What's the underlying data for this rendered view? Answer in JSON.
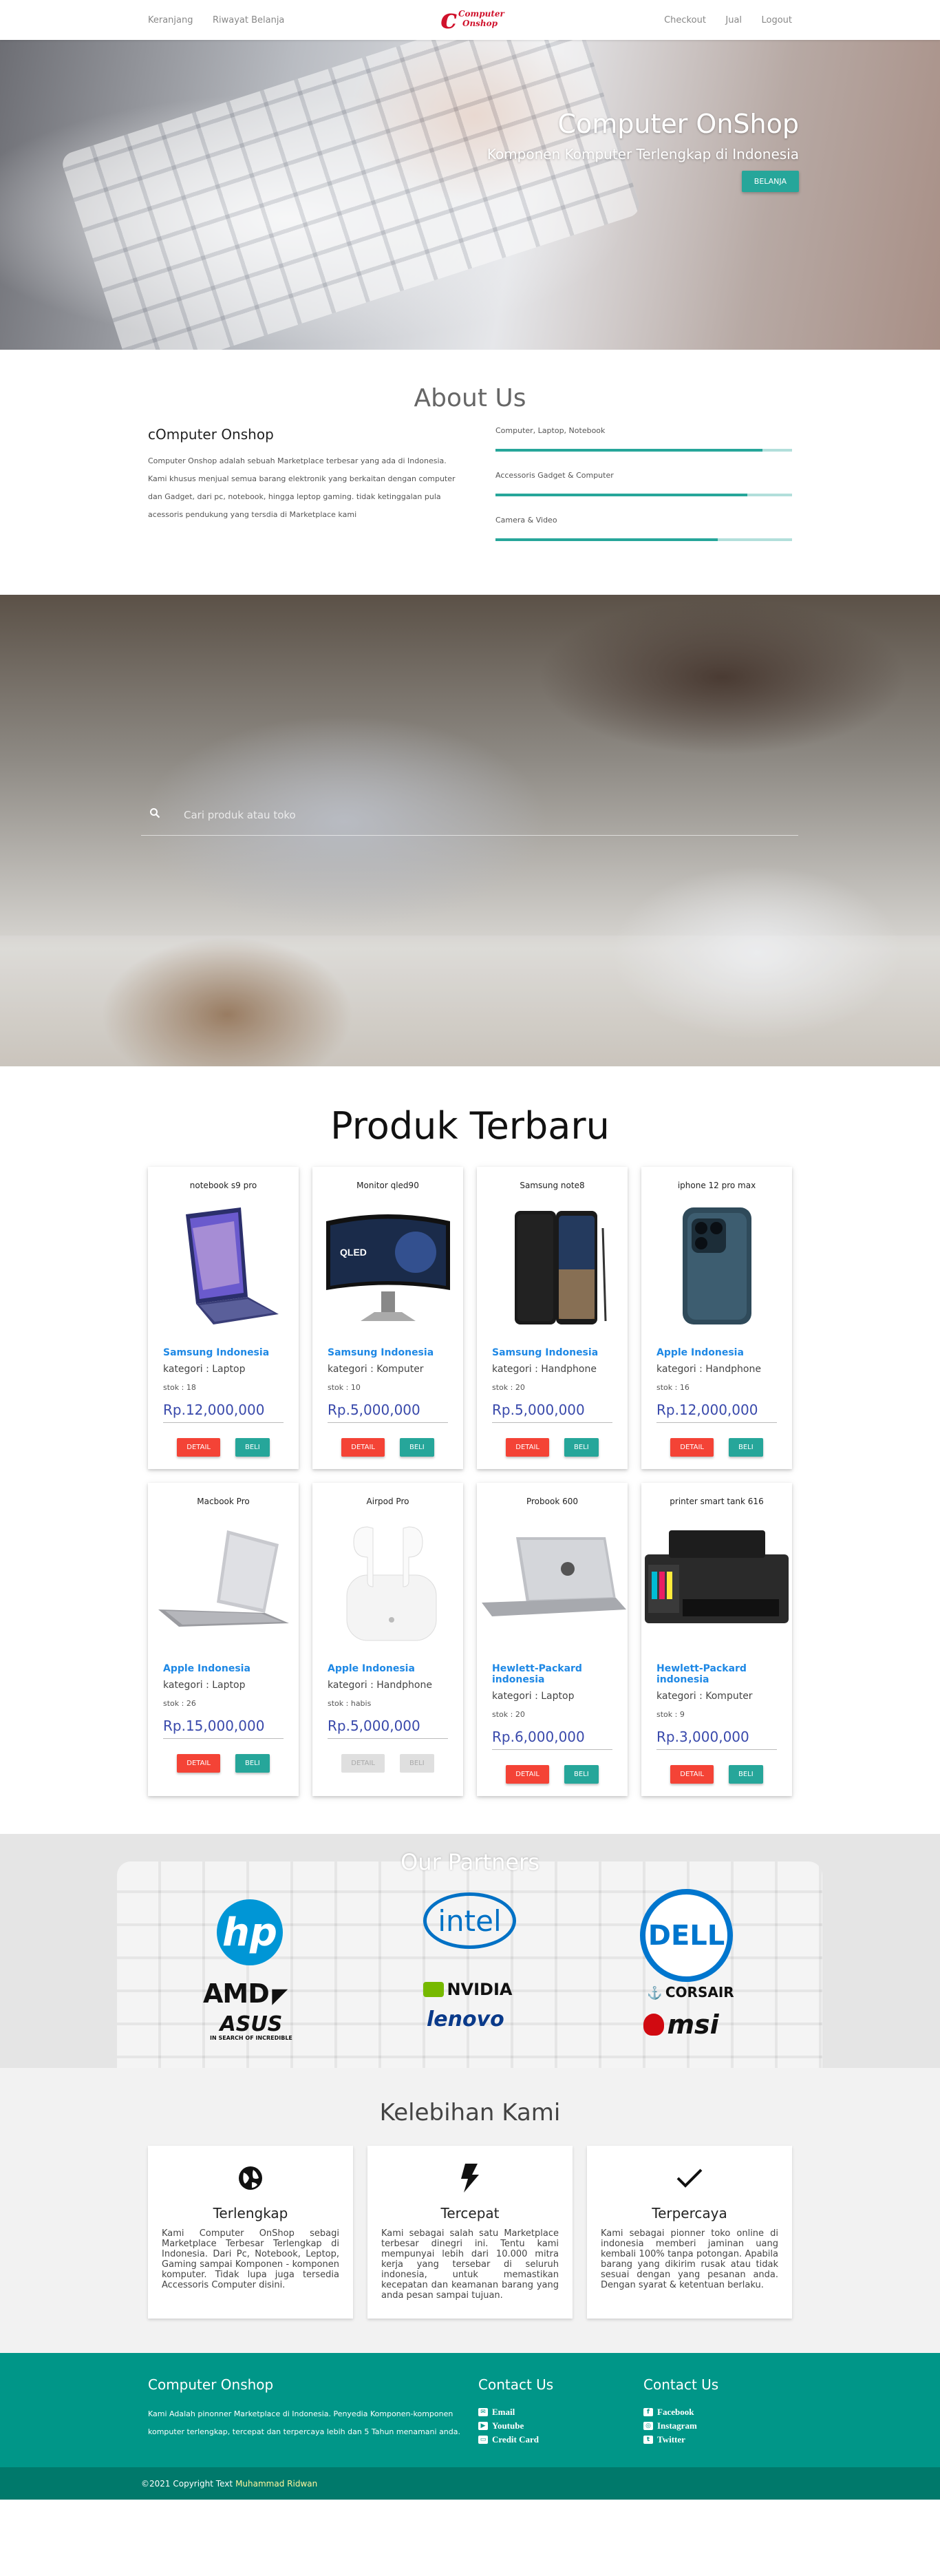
{
  "nav": {
    "left": [
      "Keranjang",
      "Riwayat Belanja"
    ],
    "right": [
      "Checkout",
      "Jual",
      "Logout"
    ],
    "logo_top": "Computer",
    "logo_bottom": "Onshop"
  },
  "hero": {
    "title": "Computer OnShop",
    "subtitle": "Komponen Komputer Terlengkap di Indonesia",
    "button": "BELANJA"
  },
  "about": {
    "heading": "About Us",
    "subheading": "cOmputer Onshop",
    "text": "Computer Onshop adalah sebuah Marketplace terbesar yang ada di Indonesia. Kami khusus menjual semua barang elektronik yang berkaitan dengan computer dan Gadget, dari pc, notebook, hingga leptop gaming. tidak ketinggalan pula acessoris pendukung yang tersdia di Marketplace kami",
    "skills": [
      {
        "label": "Computer, Laptop, Notebook",
        "level": 0.9
      },
      {
        "label": "Accessoris Gadget & Computer",
        "level": 0.85
      },
      {
        "label": "Camera & Video",
        "level": 0.75
      }
    ]
  },
  "search": {
    "placeholder": "Cari produk atau toko"
  },
  "products": {
    "heading": "Produk Terbaru",
    "items": [
      {
        "name": "notebook s9 pro",
        "brand": "Samsung Indonesia",
        "category": "kategori : Laptop",
        "stock": "stok : 18",
        "price": "Rp.12,000,000",
        "detail": "DETAIL",
        "buy": "BELI",
        "img": "laptop-flip-icon",
        "enabled": true
      },
      {
        "name": "Monitor qled90",
        "brand": "Samsung Indonesia",
        "category": "kategori : Komputer",
        "stock": "stok : 10",
        "price": "Rp.5,000,000",
        "detail": "DETAIL",
        "buy": "BELI",
        "img": "monitor-icon",
        "enabled": true
      },
      {
        "name": "Samsung note8",
        "brand": "Samsung Indonesia",
        "category": "kategori : Handphone",
        "stock": "stok : 20",
        "price": "Rp.5,000,000",
        "detail": "DETAIL",
        "buy": "BELI",
        "img": "phone-icon",
        "enabled": true
      },
      {
        "name": "iphone 12 pro max",
        "brand": "Apple Indonesia",
        "category": "kategori : Handphone",
        "stock": "stok : 16",
        "price": "Rp.12,000,000",
        "detail": "DETAIL",
        "buy": "BELI",
        "img": "iphone-icon",
        "enabled": true
      },
      {
        "name": "Macbook Pro",
        "brand": "Apple Indonesia",
        "category": "kategori : Laptop",
        "stock": "stok : 26",
        "price": "Rp.15,000,000",
        "detail": "DETAIL",
        "buy": "BELI",
        "img": "macbook-icon",
        "enabled": true
      },
      {
        "name": "Airpod Pro",
        "brand": "Apple Indonesia",
        "category": "kategori : Handphone",
        "stock": "stok : habis",
        "price": "Rp.5,000,000",
        "detail": "DETAIL",
        "buy": "BELI",
        "img": "airpods-icon",
        "enabled": false
      },
      {
        "name": "Probook 600",
        "brand": "Hewlett-Packard indonesia",
        "category": "kategori : Laptop",
        "stock": "stok : 20",
        "price": "Rp.6,000,000",
        "detail": "DETAIL",
        "buy": "BELI",
        "img": "probook-icon",
        "enabled": true
      },
      {
        "name": "printer smart tank 616",
        "brand": "Hewlett-Packard indonesia",
        "category": "kategori : Komputer",
        "stock": "stok : 9",
        "price": "Rp.3,000,000",
        "detail": "DETAIL",
        "buy": "BELI",
        "img": "printer-icon",
        "enabled": true
      }
    ]
  },
  "partners": {
    "heading": "Our Partners",
    "logos": [
      "hp",
      "intel",
      "DELL",
      "AMD",
      "NVIDIA",
      "CORSAIR",
      "ASUS",
      "lenovo",
      "msi"
    ],
    "asus_tagline": "IN SEARCH OF INCREDIBLE"
  },
  "kelebihan": {
    "heading": "Kelebihan Kami",
    "items": [
      {
        "icon": "globe-icon",
        "title": "Terlengkap",
        "text": "Kami Computer OnShop sebagi Marketplace Terbesar Terlengkap di Indonesia. Dari Pc, Notebook, Leptop, Gaming sampai Komponen - komponen komputer. Tidak lupa juga tersedia Accessoris Computer disini."
      },
      {
        "icon": "bolt-icon",
        "title": "Tercepat",
        "text": "Kami sebagai salah satu Marketplace terbesar dinegri ini. Tentu kami mempunyai lebih dari 10.000 mitra kerja yang tersebar di seluruh indonesia, untuk memastikan kecepatan dan keamanan barang yang anda pesan sampai tujuan."
      },
      {
        "icon": "check-icon",
        "title": "Terpercaya",
        "text": "Kami sebagai pionner toko online di indonesia memberi jaminan uang kembali 100% tanpa potongan. Apabila barang yang dikirim rusak atau tidak sesuai dengan yang pesanan anda. Dengan syarat & ketentuan berlaku."
      }
    ]
  },
  "footer": {
    "title": "Computer Onshop",
    "text": "Kami Adalah pinonner Marketplace di Indonesia. Penyedia Komponen-komponen komputer terlengkap, tercepat dan terpercaya lebih dan 5 Tahun menamani anda.",
    "contact1_title": "Contact Us",
    "contact1": [
      "Email",
      "Youtube",
      "Credit Card"
    ],
    "contact2_title": "Contact Us",
    "contact2": [
      "Facebook",
      "Instagram",
      "Twitter"
    ],
    "copyright": "©2021 Copyright Text",
    "author": "Muhammad Ridwan"
  },
  "colors": {
    "accent": "#26a69a",
    "brand_red": "#d0122c",
    "price": "#3949ab",
    "link": "#1e88e5",
    "footer": "#009688"
  }
}
